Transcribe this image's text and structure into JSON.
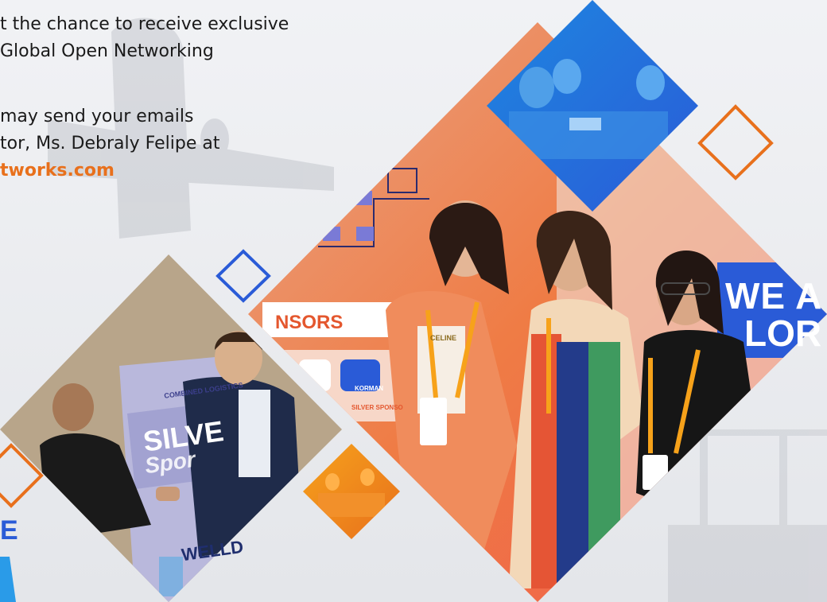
{
  "copy": {
    "line1": "t the chance to receive exclusive",
    "line2": "Global Open Networking",
    "line3": "may send your emails",
    "line4": "tor, Ms. Debraly Felipe at",
    "line5": "tworks.com"
  },
  "photo_labels": {
    "sonsors": "NSORS",
    "we": "WE A",
    "lor": "LOR",
    "silve": "SILVE",
    "spor": "Spor",
    "combined": "COMBINED LOGISTICS",
    "welld": "WELLD",
    "celine": "CELINE",
    "korman": "KORMAN",
    "silver_spon": "SILVER SPONSO",
    "e_letter": "E"
  },
  "colors": {
    "accent_orange": "#e8701c",
    "accent_blue": "#2a5bd7",
    "orange_backdrop": "#ef7c45"
  }
}
